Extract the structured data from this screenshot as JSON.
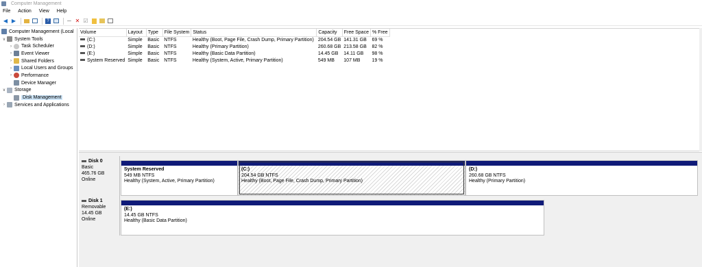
{
  "window": {
    "title": "Computer Management"
  },
  "menu": [
    "File",
    "Action",
    "View",
    "Help"
  ],
  "toolbar": [
    "back-icon",
    "forward-icon",
    "up-folder-icon",
    "console-tree-icon",
    "help-icon",
    "list-view-icon",
    "connect-icon",
    "delete-icon",
    "check-icon",
    "properties-icon",
    "disk-icon",
    "help-topics-icon"
  ],
  "tree": [
    {
      "label": "Computer Management (Local",
      "level": 0,
      "exp": "",
      "icon": "computer-icon"
    },
    {
      "label": "System Tools",
      "level": 0,
      "exp": "v",
      "icon": "tools-icon"
    },
    {
      "label": "Task Scheduler",
      "level": 1,
      "exp": ">",
      "icon": "scheduler-icon"
    },
    {
      "label": "Event Viewer",
      "level": 1,
      "exp": ">",
      "icon": "event-viewer-icon"
    },
    {
      "label": "Shared Folders",
      "level": 1,
      "exp": ">",
      "icon": "shared-folder-icon"
    },
    {
      "label": "Local Users and Groups",
      "level": 1,
      "exp": ">",
      "icon": "users-icon"
    },
    {
      "label": "Performance",
      "level": 1,
      "exp": ">",
      "icon": "performance-icon"
    },
    {
      "label": "Device Manager",
      "level": 1,
      "exp": "",
      "icon": "device-manager-icon"
    },
    {
      "label": "Storage",
      "level": 0,
      "exp": "v",
      "icon": "storage-icon"
    },
    {
      "label": "Disk Management",
      "level": 1,
      "exp": "",
      "icon": "disk-management-icon",
      "selected": true
    },
    {
      "label": "Services and Applications",
      "level": 0,
      "exp": ">",
      "icon": "services-icon"
    }
  ],
  "volume_columns": [
    "Volume",
    "Layout",
    "Type",
    "File System",
    "Status",
    "Capacity",
    "Free Space",
    "% Free"
  ],
  "volumes": [
    [
      "(C:)",
      "Simple",
      "Basic",
      "NTFS",
      "Healthy (Boot, Page File, Crash Dump, Primary Partition)",
      "204.54 GB",
      "141.31 GB",
      "69 %"
    ],
    [
      "(D:)",
      "Simple",
      "Basic",
      "NTFS",
      "Healthy (Primary Partition)",
      "260.68 GB",
      "213.58 GB",
      "82 %"
    ],
    [
      "(E:)",
      "Simple",
      "Basic",
      "NTFS",
      "Healthy (Basic Data Partition)",
      "14.45 GB",
      "14.11 GB",
      "98 %"
    ],
    [
      "System Reserved",
      "Simple",
      "Basic",
      "NTFS",
      "Healthy (System, Active, Primary Partition)",
      "549 MB",
      "107 MB",
      "19 %"
    ]
  ],
  "disks": [
    {
      "name": "Disk 0",
      "type": "Basic",
      "size": "465.76 GB",
      "state": "Online",
      "partitions": [
        {
          "name": "System Reserved",
          "size": "549 MB NTFS",
          "status": "Healthy (System, Active, Primary Partition)"
        },
        {
          "name": "(C:)",
          "size": "204.54 GB NTFS",
          "status": "Healthy (Boot, Page File, Crash Dump, Primary Partition)",
          "hatched": true
        },
        {
          "name": "(D:)",
          "size": "260.68 GB NTFS",
          "status": "Healthy (Primary Partition)"
        }
      ]
    },
    {
      "name": "Disk 1",
      "type": "Removable",
      "size": "14.45 GB",
      "state": "Online",
      "partitions": [
        {
          "name": "(E:)",
          "size": "14.45 GB NTFS",
          "status": "Healthy (Basic Data Partition)"
        }
      ]
    }
  ],
  "colors": {
    "partition_bar": "#0f1a78",
    "selection": "#cce4f7"
  }
}
